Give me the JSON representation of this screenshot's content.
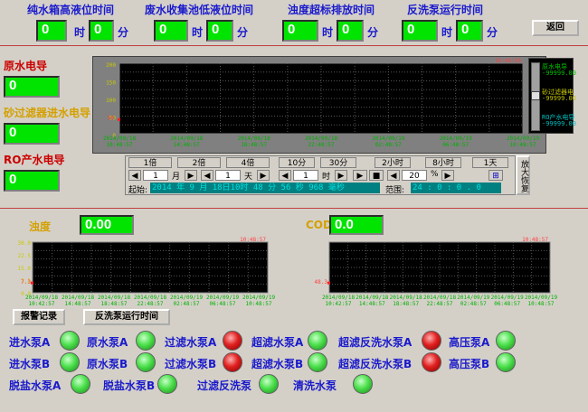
{
  "timers": [
    {
      "title": "纯水箱高液位时间",
      "hours": "0",
      "minutes": "0",
      "hour_unit": "时",
      "min_unit": "分"
    },
    {
      "title": "废水收集池低液位时间",
      "hours": "0",
      "minutes": "0",
      "hour_unit": "时",
      "min_unit": "分"
    },
    {
      "title": "浊度超标排放时间",
      "hours": "0",
      "minutes": "0",
      "hour_unit": "时",
      "min_unit": "分"
    },
    {
      "title": "反洗泵运行时间",
      "hours": "0",
      "minutes": "0",
      "hour_unit": "时",
      "min_unit": "分"
    }
  ],
  "back_button": "返回",
  "left_readings": [
    {
      "label": "原水电导",
      "value": "0"
    },
    {
      "label": "砂过滤器进水电导",
      "value": "0"
    },
    {
      "label": "RO产水电导",
      "value": "0"
    }
  ],
  "main_chart": {
    "timestamp": "10:48:56",
    "y_ticks": [
      "200",
      "150",
      "100",
      "50",
      "0"
    ],
    "y_marker": "50",
    "x_labels": [
      {
        "date": "2014/09/18",
        "time": "10:48:57"
      },
      {
        "date": "2014/09/18",
        "time": "14:48:57"
      },
      {
        "date": "2014/09/18",
        "time": "18:48:57"
      },
      {
        "date": "2014/09/18",
        "time": "22:48:57"
      },
      {
        "date": "2014/09/19",
        "time": "02:48:57"
      },
      {
        "date": "2014/09/19",
        "time": "06:48:57"
      },
      {
        "date": "2014/09/19",
        "time": "10:48:57"
      }
    ],
    "legend": [
      {
        "name": "原水电导",
        "value": "-99999.00",
        "color": "#00c000"
      },
      {
        "name": "砂过滤器电",
        "value": "-99999.00",
        "color": "#c8c800"
      },
      {
        "name": "RO产水电导",
        "value": "-99999.00",
        "color": "#00c0c0"
      }
    ]
  },
  "chart_controls": {
    "zoom_buttons": [
      "1倍",
      "2倍",
      "4倍",
      "10分",
      "30分",
      "2小时",
      "8小时",
      "1天"
    ],
    "month_value": "1",
    "month_unit": "月",
    "day_value": "1",
    "day_unit": "天",
    "hour_value": "1",
    "hour_unit": "时",
    "percent_value": "20",
    "percent_unit": "%",
    "start_label": "起始:",
    "start_value": "2014 年 9 月 18日10时 48 分 56 秒 968 毫秒",
    "range_label": "范围:",
    "range_value": "24 : 0 : 0 . 0",
    "restore_button": "放大恢复"
  },
  "turbidity": {
    "label": "浊度",
    "value": "0.00",
    "timestamp": "10:48:57",
    "y_ticks": [
      "30.0",
      "22.5",
      "15.0",
      "7.5",
      "0.0"
    ],
    "y_marker": "7.3"
  },
  "cod": {
    "label": "COD",
    "value": "0.0",
    "timestamp": "10:48:57",
    "y_marker": "48.3"
  },
  "small_x_labels": [
    {
      "date": "2014/09/18",
      "time": "10:42:57"
    },
    {
      "date": "2014/09/18",
      "time": "14:48:57"
    },
    {
      "date": "2014/09/18",
      "time": "18:48:57"
    },
    {
      "date": "2014/09/18",
      "time": "22:48:57"
    },
    {
      "date": "2014/09/19",
      "time": "02:48:57"
    },
    {
      "date": "2014/09/19",
      "time": "06:48:57"
    },
    {
      "date": "2014/09/19",
      "time": "10:48:57"
    }
  ],
  "alarm_button": "报警记录",
  "backwash_button": "反洗泵运行时间",
  "pumps_row1": [
    {
      "label": "进水泵A",
      "state": "green"
    },
    {
      "label": "原水泵A",
      "state": "green"
    },
    {
      "label": "过滤水泵A",
      "state": "red"
    },
    {
      "label": "超滤水泵A",
      "state": "green"
    },
    {
      "label": "超滤反洗水泵A",
      "state": "red"
    },
    {
      "label": "高压泵A",
      "state": "green"
    }
  ],
  "pumps_row2": [
    {
      "label": "进水泵B",
      "state": "green"
    },
    {
      "label": "原水泵B",
      "state": "green"
    },
    {
      "label": "过滤水泵B",
      "state": "red"
    },
    {
      "label": "超滤水泵B",
      "state": "green"
    },
    {
      "label": "超滤反洗水泵B",
      "state": "red"
    },
    {
      "label": "高压泵B",
      "state": "green"
    }
  ],
  "pumps_row3": [
    {
      "label": "脱盐水泵A",
      "state": "green"
    },
    {
      "label": "脱盐水泵B",
      "state": "green"
    },
    {
      "label": "过滤反洗泵",
      "state": "green"
    },
    {
      "label": "清洗水泵",
      "state": "green"
    }
  ]
}
